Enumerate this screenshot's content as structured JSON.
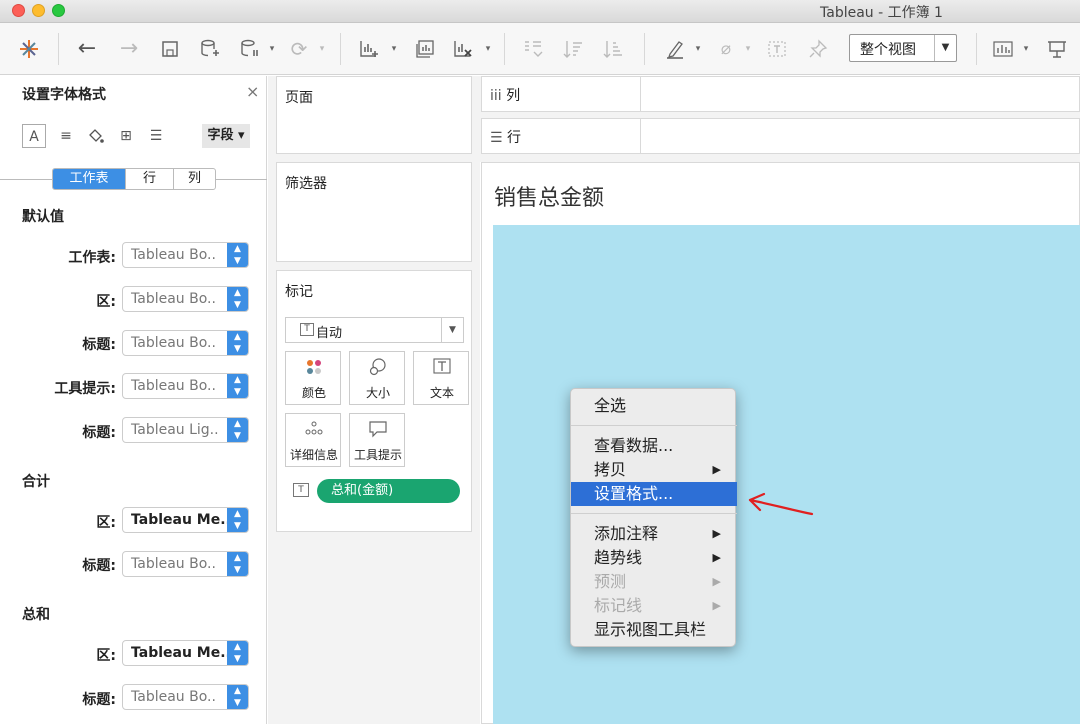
{
  "window": {
    "title": "Tableau - 工作簿 1"
  },
  "toolbar": {
    "view_mode": "整个视图"
  },
  "format_panel": {
    "title": "设置字体格式",
    "scope_dropdown": "字段",
    "tabs": [
      "工作表",
      "行",
      "列"
    ],
    "sections": [
      {
        "label": "默认值",
        "rows": [
          {
            "label": "工作表:",
            "value": "Tableau Bo.."
          },
          {
            "label": "区:",
            "value": "Tableau Bo.."
          },
          {
            "label": "标题:",
            "value": "Tableau Bo.."
          },
          {
            "label": "工具提示:",
            "value": "Tableau Bo.."
          },
          {
            "label": "标题:",
            "value": "Tableau Lig.."
          }
        ]
      },
      {
        "label": "合计",
        "rows": [
          {
            "label": "区:",
            "value": "Tableau Me.."
          },
          {
            "label": "标题:",
            "value": "Tableau Bo.."
          }
        ]
      },
      {
        "label": "总和",
        "rows": [
          {
            "label": "区:",
            "value": "Tableau Me.."
          },
          {
            "label": "标题:",
            "value": "Tableau Bo.."
          }
        ]
      }
    ]
  },
  "cards": {
    "pages": "页面",
    "filters": "筛选器",
    "marks": {
      "title": "标记",
      "type": "自动",
      "buttons": [
        "颜色",
        "大小",
        "文本",
        "详细信息",
        "工具提示"
      ],
      "pill": "总和(金额)"
    }
  },
  "shelves": {
    "columns": "列",
    "rows": "行"
  },
  "view": {
    "title": "销售总金额",
    "fill_color": "#aee1f1"
  },
  "context_menu": {
    "items": [
      {
        "label": "全选",
        "submenu": false,
        "disabled": false
      },
      {
        "label": "查看数据...",
        "submenu": false,
        "disabled": false
      },
      {
        "label": "拷贝",
        "submenu": true,
        "disabled": false
      },
      {
        "label": "设置格式...",
        "submenu": false,
        "disabled": false,
        "highlighted": true
      },
      {
        "label": "添加注释",
        "submenu": true,
        "disabled": false
      },
      {
        "label": "趋势线",
        "submenu": true,
        "disabled": false
      },
      {
        "label": "预测",
        "submenu": true,
        "disabled": true
      },
      {
        "label": "标记线",
        "submenu": true,
        "disabled": true
      },
      {
        "label": "显示视图工具栏",
        "submenu": false,
        "disabled": false
      }
    ]
  },
  "colors": {
    "accent": "#3d8fe4",
    "pill": "#1aa570",
    "highlight": "#2d6fd6",
    "annotation_arrow": "#e02020"
  }
}
